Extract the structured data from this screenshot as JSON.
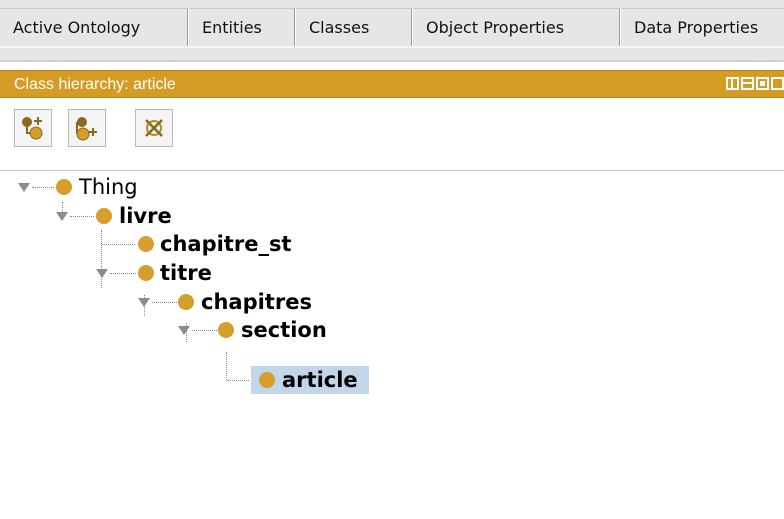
{
  "tabs": [
    {
      "label": "Active Ontology"
    },
    {
      "label": "Entities"
    },
    {
      "label": "Classes"
    },
    {
      "label": "Object Properties"
    },
    {
      "label": "Data Properties"
    }
  ],
  "view": {
    "title": "Class hierarchy: article"
  },
  "toolbar": {
    "buttons": [
      {
        "icon": "add-subclass-icon"
      },
      {
        "icon": "add-sibling-class-icon"
      },
      {
        "icon": "delete-class-icon"
      }
    ]
  },
  "tree": {
    "nodes": [
      {
        "label": "Thing",
        "depth": 0,
        "expanded": true,
        "bold": false
      },
      {
        "label": "livre",
        "depth": 1,
        "expanded": true,
        "bold": true
      },
      {
        "label": "chapitre_st",
        "depth": 2,
        "expanded": false,
        "bold": true
      },
      {
        "label": "titre",
        "depth": 2,
        "expanded": true,
        "bold": true
      },
      {
        "label": "chapitres",
        "depth": 3,
        "expanded": true,
        "bold": true
      },
      {
        "label": "section",
        "depth": 4,
        "expanded": true,
        "bold": true
      },
      {
        "label": "article",
        "depth": 5,
        "expanded": false,
        "bold": true,
        "selected": true
      }
    ]
  },
  "colors": {
    "header": "#d49c24",
    "class_dot": "#d69e2a",
    "selection": "#c2d6ea"
  }
}
